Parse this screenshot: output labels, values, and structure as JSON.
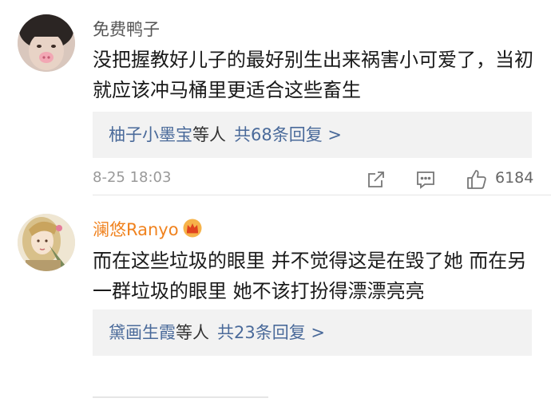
{
  "comments": [
    {
      "username": "免费鸭子",
      "text": "没把握教好儿子的最好别生出来祸害小可爱了，当初就应该冲马桶里更适合这些畜生",
      "reply_users": "柚子小墨宝",
      "reply_suffix": "等人",
      "reply_total": "共68条回复 >",
      "timestamp": "8-25 18:03",
      "likes": "6184"
    },
    {
      "username": "澜悠Ranyo",
      "text": "而在这些垃圾的眼里 并不觉得这是在毁了她 而在另一群垃圾的眼里 她不该打扮得漂漂亮亮",
      "reply_users": "黛画生霞",
      "reply_suffix": "等人",
      "reply_total": "共23条回复 >"
    }
  ],
  "icons": [
    "share-icon",
    "comment-icon",
    "like-icon",
    "crown-badge-icon"
  ],
  "colors": {
    "link_blue": "#4a6a9a",
    "vip_orange": "#f0821e",
    "reply_bg": "#f2f2f2"
  }
}
